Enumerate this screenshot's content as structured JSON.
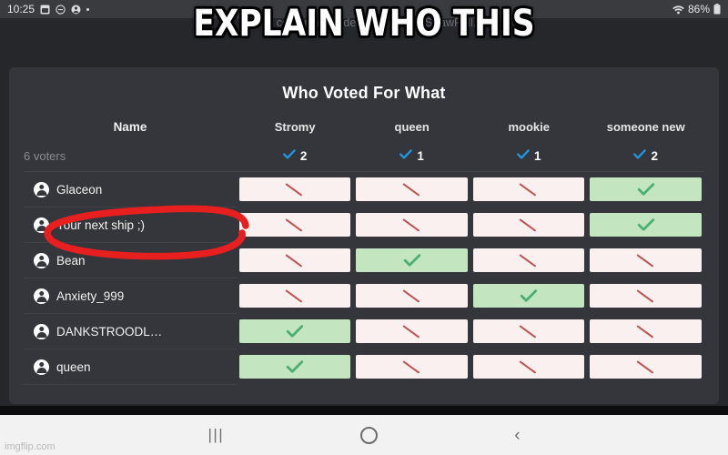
{
  "statusbar": {
    "time": "10:25",
    "icons_left": [
      "sim-card-icon",
      "do-not-disturb-icon",
      "account-icon",
      "dot-icon"
    ],
    "wifi_icon": "wifi-icon",
    "battery_percent": "86%",
    "battery_icon": "battery-icon"
  },
  "background_note": "This content is hidden. Not part of StrawPoll.",
  "meme": {
    "caption": "EXPLAIN WHO THIS"
  },
  "poll": {
    "title": "Who Voted For What",
    "name_header": "Name",
    "voters_label": "6 voters",
    "options": [
      {
        "label": "Stromy",
        "count": "2"
      },
      {
        "label": "queen",
        "count": "1"
      },
      {
        "label": "mookie",
        "count": "1"
      },
      {
        "label": "someone new",
        "count": "2"
      }
    ],
    "rows": [
      {
        "name": "Glaceon",
        "votes": [
          false,
          false,
          false,
          true
        ]
      },
      {
        "name": "Your next ship ;)",
        "votes": [
          false,
          false,
          false,
          true
        ]
      },
      {
        "name": "Bean",
        "votes": [
          false,
          true,
          false,
          false
        ]
      },
      {
        "name": "Anxiety_999",
        "votes": [
          false,
          false,
          true,
          false
        ]
      },
      {
        "name": "DANKSTROODL…",
        "votes": [
          true,
          false,
          false,
          false
        ]
      },
      {
        "name": "queen",
        "votes": [
          true,
          false,
          false,
          false
        ]
      }
    ],
    "yes_icon": "check-icon",
    "no_icon": "slash-icon",
    "tally_icon": "check-icon"
  },
  "annotation": {
    "shape": "red-circle-highlight",
    "target": "Your next ship ;)",
    "color": "#e81f1f"
  },
  "navbar": {
    "recents_icon": "recents-icon",
    "recents_glyph": "|||",
    "home_icon": "home-icon",
    "back_icon": "back-icon",
    "back_glyph": "‹",
    "watermark": "imgflip.com"
  },
  "colors": {
    "page_bg": "#26272b",
    "card_bg": "#35363c",
    "yes_cell": "#c3e6c1",
    "yes_check": "#4caf72",
    "no_cell": "#faf0ef",
    "no_slash": "#c0524f",
    "tally_blue": "#2196e3",
    "annotation_red": "#e81f1f"
  }
}
